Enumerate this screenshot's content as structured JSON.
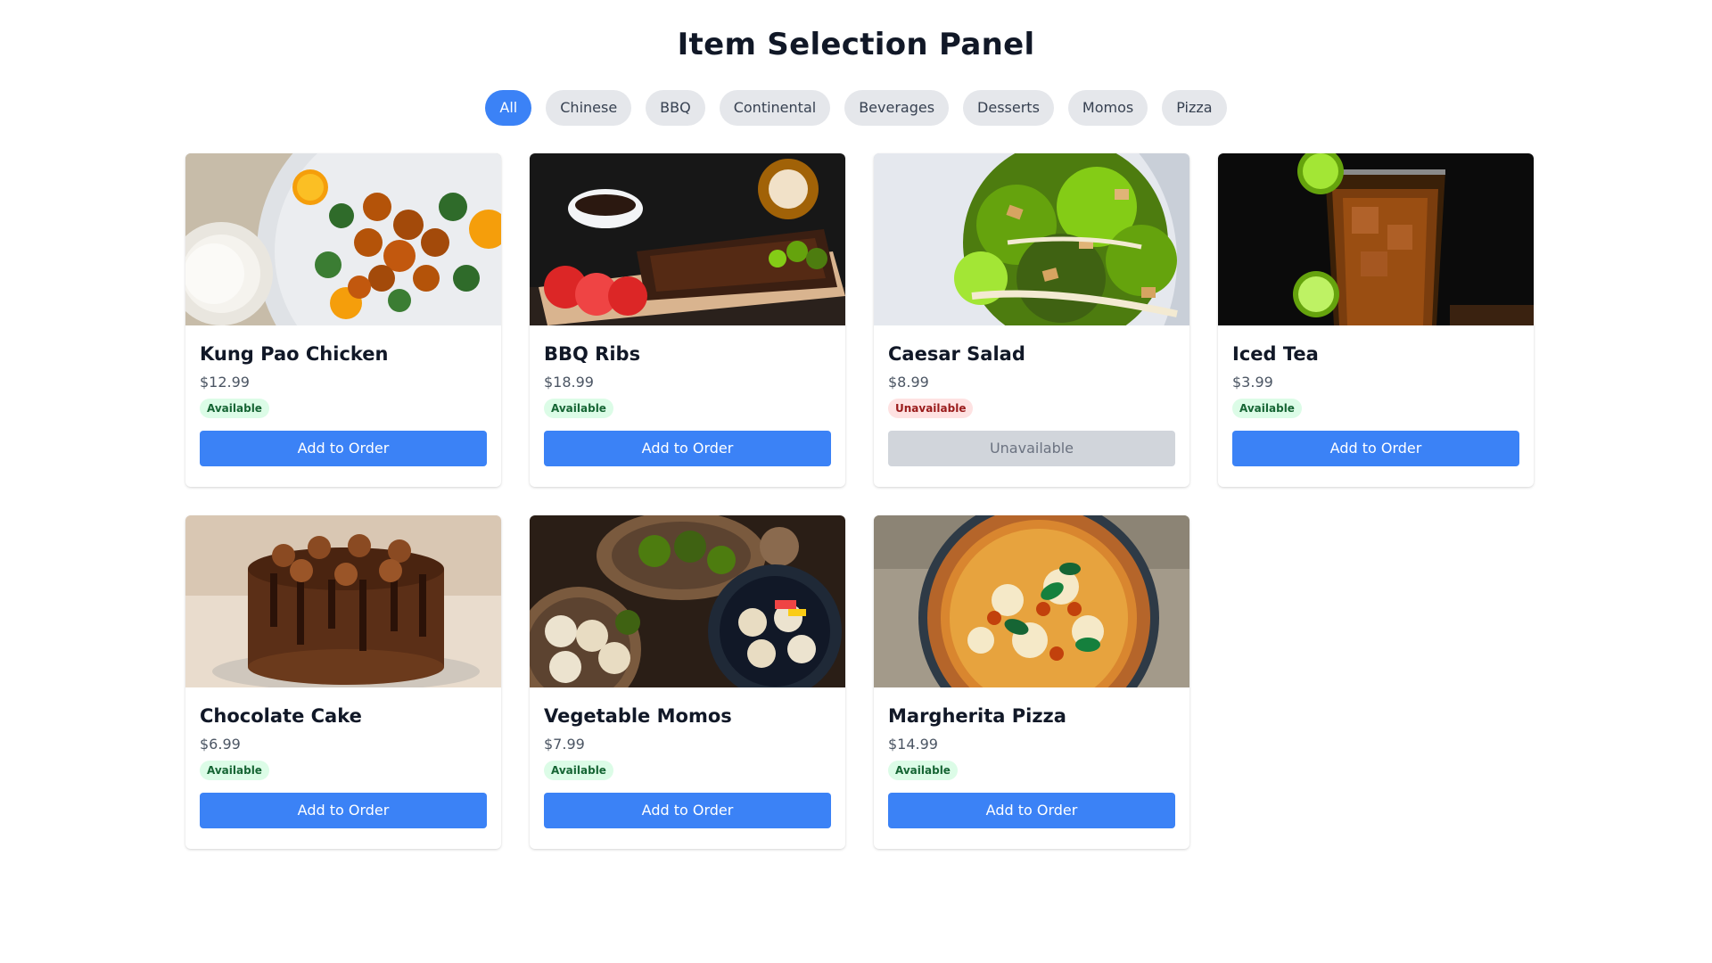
{
  "header": {
    "title": "Item Selection Panel"
  },
  "filters": {
    "active": "All",
    "items": [
      "All",
      "Chinese",
      "BBQ",
      "Continental",
      "Beverages",
      "Desserts",
      "Momos",
      "Pizza"
    ]
  },
  "colors": {
    "accent": "#3b82f6",
    "chip_bg": "#e5e7eb",
    "available_bg": "#dcfce7",
    "available_text": "#166534",
    "unavailable_bg": "#fee2e2",
    "unavailable_text": "#991b1b",
    "disabled_button": "#d1d5db"
  },
  "items": [
    {
      "name": "Kung Pao Chicken",
      "price": "$12.99",
      "status": "Available",
      "available": true,
      "button": "Add to Order",
      "image": "kung-pao-chicken-photo"
    },
    {
      "name": "BBQ Ribs",
      "price": "$18.99",
      "status": "Available",
      "available": true,
      "button": "Add to Order",
      "image": "bbq-ribs-photo"
    },
    {
      "name": "Caesar Salad",
      "price": "$8.99",
      "status": "Unavailable",
      "available": false,
      "button": "Unavailable",
      "image": "caesar-salad-photo"
    },
    {
      "name": "Iced Tea",
      "price": "$3.99",
      "status": "Available",
      "available": true,
      "button": "Add to Order",
      "image": "iced-tea-photo"
    },
    {
      "name": "Chocolate Cake",
      "price": "$6.99",
      "status": "Available",
      "available": true,
      "button": "Add to Order",
      "image": "chocolate-cake-photo"
    },
    {
      "name": "Vegetable Momos",
      "price": "$7.99",
      "status": "Available",
      "available": true,
      "button": "Add to Order",
      "image": "vegetable-momos-photo"
    },
    {
      "name": "Margherita Pizza",
      "price": "$14.99",
      "status": "Available",
      "available": true,
      "button": "Add to Order",
      "image": "margherita-pizza-photo"
    }
  ]
}
